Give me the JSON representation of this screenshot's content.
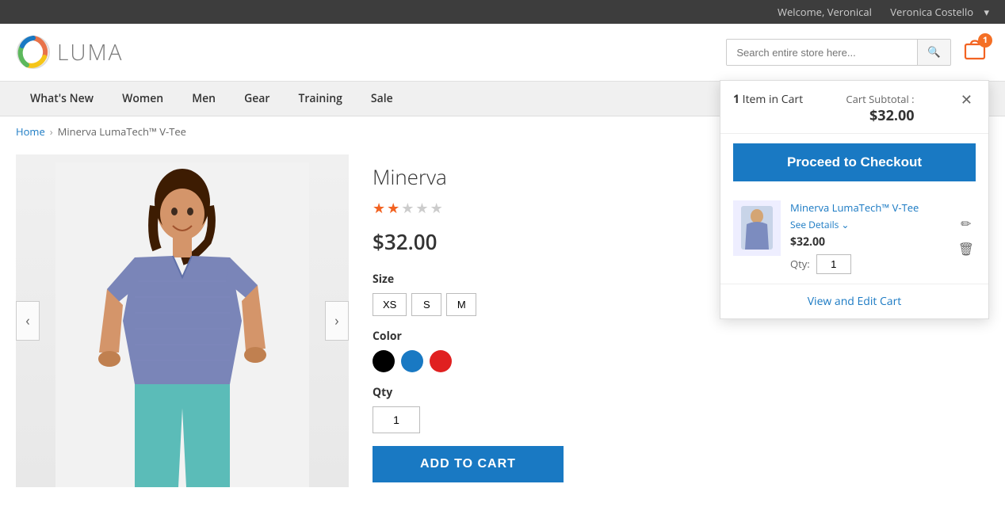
{
  "topbar": {
    "welcome_text": "Welcome, Veronical",
    "user_name": "Veronica Costello",
    "dropdown_icon": "▾"
  },
  "header": {
    "logo_text": "LUMA",
    "search_placeholder": "Search entire store here...",
    "cart_count": "1"
  },
  "nav": {
    "items": [
      {
        "label": "What's New"
      },
      {
        "label": "Women"
      },
      {
        "label": "Men"
      },
      {
        "label": "Gear"
      },
      {
        "label": "Training"
      },
      {
        "label": "Sale"
      }
    ]
  },
  "breadcrumb": {
    "home": "Home",
    "current": "Minerva LumaTech™ V-Tee"
  },
  "product": {
    "title": "Minerva",
    "full_title": "Minerva LumaTech™ V-Tee",
    "price": "$32.00",
    "stars": [
      true,
      true,
      false,
      false,
      false
    ],
    "size_label": "Size",
    "sizes": [
      "XS",
      "S",
      "M"
    ],
    "color_label": "Color",
    "colors": [
      "#000000",
      "#1979c3",
      "#e02020"
    ],
    "qty_label": "Qty",
    "qty_value": "1",
    "add_to_cart_label": "Add to Cart"
  },
  "cart_dropdown": {
    "item_count": "1",
    "item_count_label": "Item in Cart",
    "subtotal_label": "Cart Subtotal :",
    "subtotal_amount": "$32.00",
    "checkout_label": "Proceed to Checkout",
    "item": {
      "name": "Minerva LumaTech&trade; V-Tee",
      "see_details": "See Details",
      "price": "$32.00",
      "qty_label": "Qty:",
      "qty_value": "1"
    },
    "view_edit_label": "View and Edit Cart"
  }
}
